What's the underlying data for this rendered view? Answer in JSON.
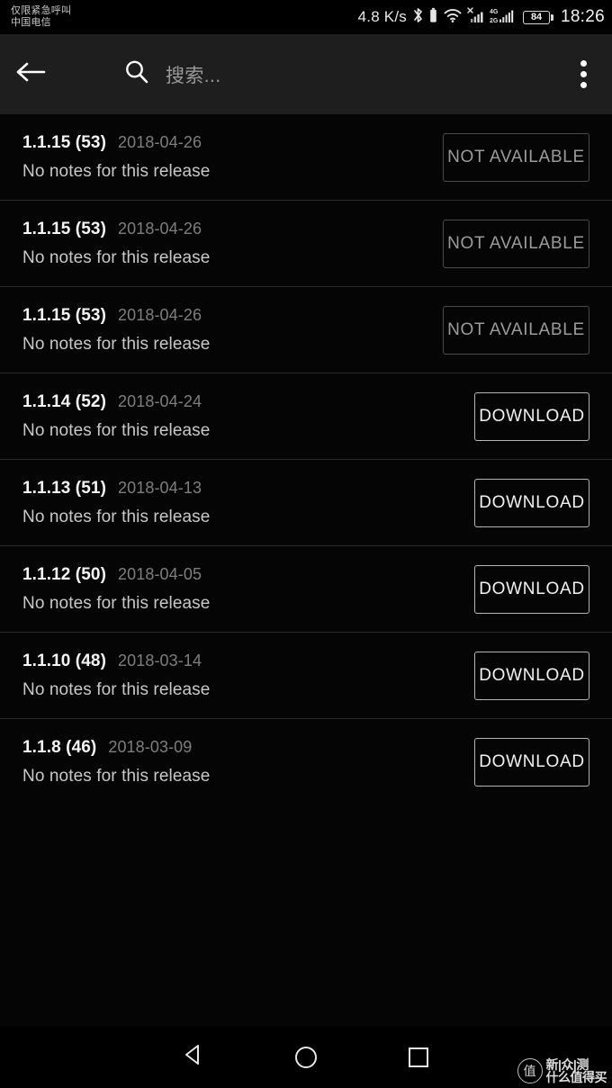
{
  "status_bar": {
    "carrier_line1": "仅限紧急呼叫",
    "carrier_line2": "中国电信",
    "net_speed": "4.8 K/s",
    "bluetooth_icon": "bluetooth-icon",
    "vibrate_icon": "vibrate-icon",
    "wifi_icon": "wifi-icon",
    "signal_no_service_icon": "signal-no-service-icon",
    "dual_signal_label_top": "4G",
    "dual_signal_label_bottom": "2G",
    "battery_level": "84",
    "clock": "18:26"
  },
  "toolbar": {
    "back_icon": "arrow-left-icon",
    "search_icon": "search-icon",
    "search_placeholder": "搜索...",
    "search_value": "",
    "overflow_icon": "more-vertical-icon"
  },
  "list": {
    "rows": [
      {
        "version": "1.1.15 (53)",
        "date": "2018-04-26",
        "notes": "No notes for this release",
        "action_label": "NOT AVAILABLE",
        "action_state": "disabled"
      },
      {
        "version": "1.1.15 (53)",
        "date": "2018-04-26",
        "notes": "No notes for this release",
        "action_label": "NOT AVAILABLE",
        "action_state": "disabled"
      },
      {
        "version": "1.1.15 (53)",
        "date": "2018-04-26",
        "notes": "No notes for this release",
        "action_label": "NOT AVAILABLE",
        "action_state": "disabled"
      },
      {
        "version": "1.1.14 (52)",
        "date": "2018-04-24",
        "notes": "No notes for this release",
        "action_label": "DOWNLOAD",
        "action_state": "enabled"
      },
      {
        "version": "1.1.13 (51)",
        "date": "2018-04-13",
        "notes": "No notes for this release",
        "action_label": "DOWNLOAD",
        "action_state": "enabled"
      },
      {
        "version": "1.1.12 (50)",
        "date": "2018-04-05",
        "notes": "No notes for this release",
        "action_label": "DOWNLOAD",
        "action_state": "enabled"
      },
      {
        "version": "1.1.10 (48)",
        "date": "2018-03-14",
        "notes": "No notes for this release",
        "action_label": "DOWNLOAD",
        "action_state": "enabled"
      },
      {
        "version": "1.1.8 (46)",
        "date": "2018-03-09",
        "notes": "No notes for this release",
        "action_label": "DOWNLOAD",
        "action_state": "enabled"
      }
    ]
  },
  "navbar": {
    "back_icon": "triangle-back-icon",
    "home_icon": "circle-home-icon",
    "recents_icon": "square-recents-icon"
  },
  "watermark": {
    "logo_glyph": "值",
    "line1": "新|众|测",
    "line2": "什么值得买"
  },
  "colors": {
    "page_background": "#050505",
    "toolbar_background": "#1e1e1e",
    "divider": "#2a2a2a",
    "primary_text": "#f5f5f5",
    "secondary_text": "#7e7e7e",
    "body_text": "#c9c9c9",
    "button_enabled_border": "#b4b4b4",
    "button_disabled_border": "#4a4a4a",
    "button_disabled_text": "#9b9b9b"
  }
}
